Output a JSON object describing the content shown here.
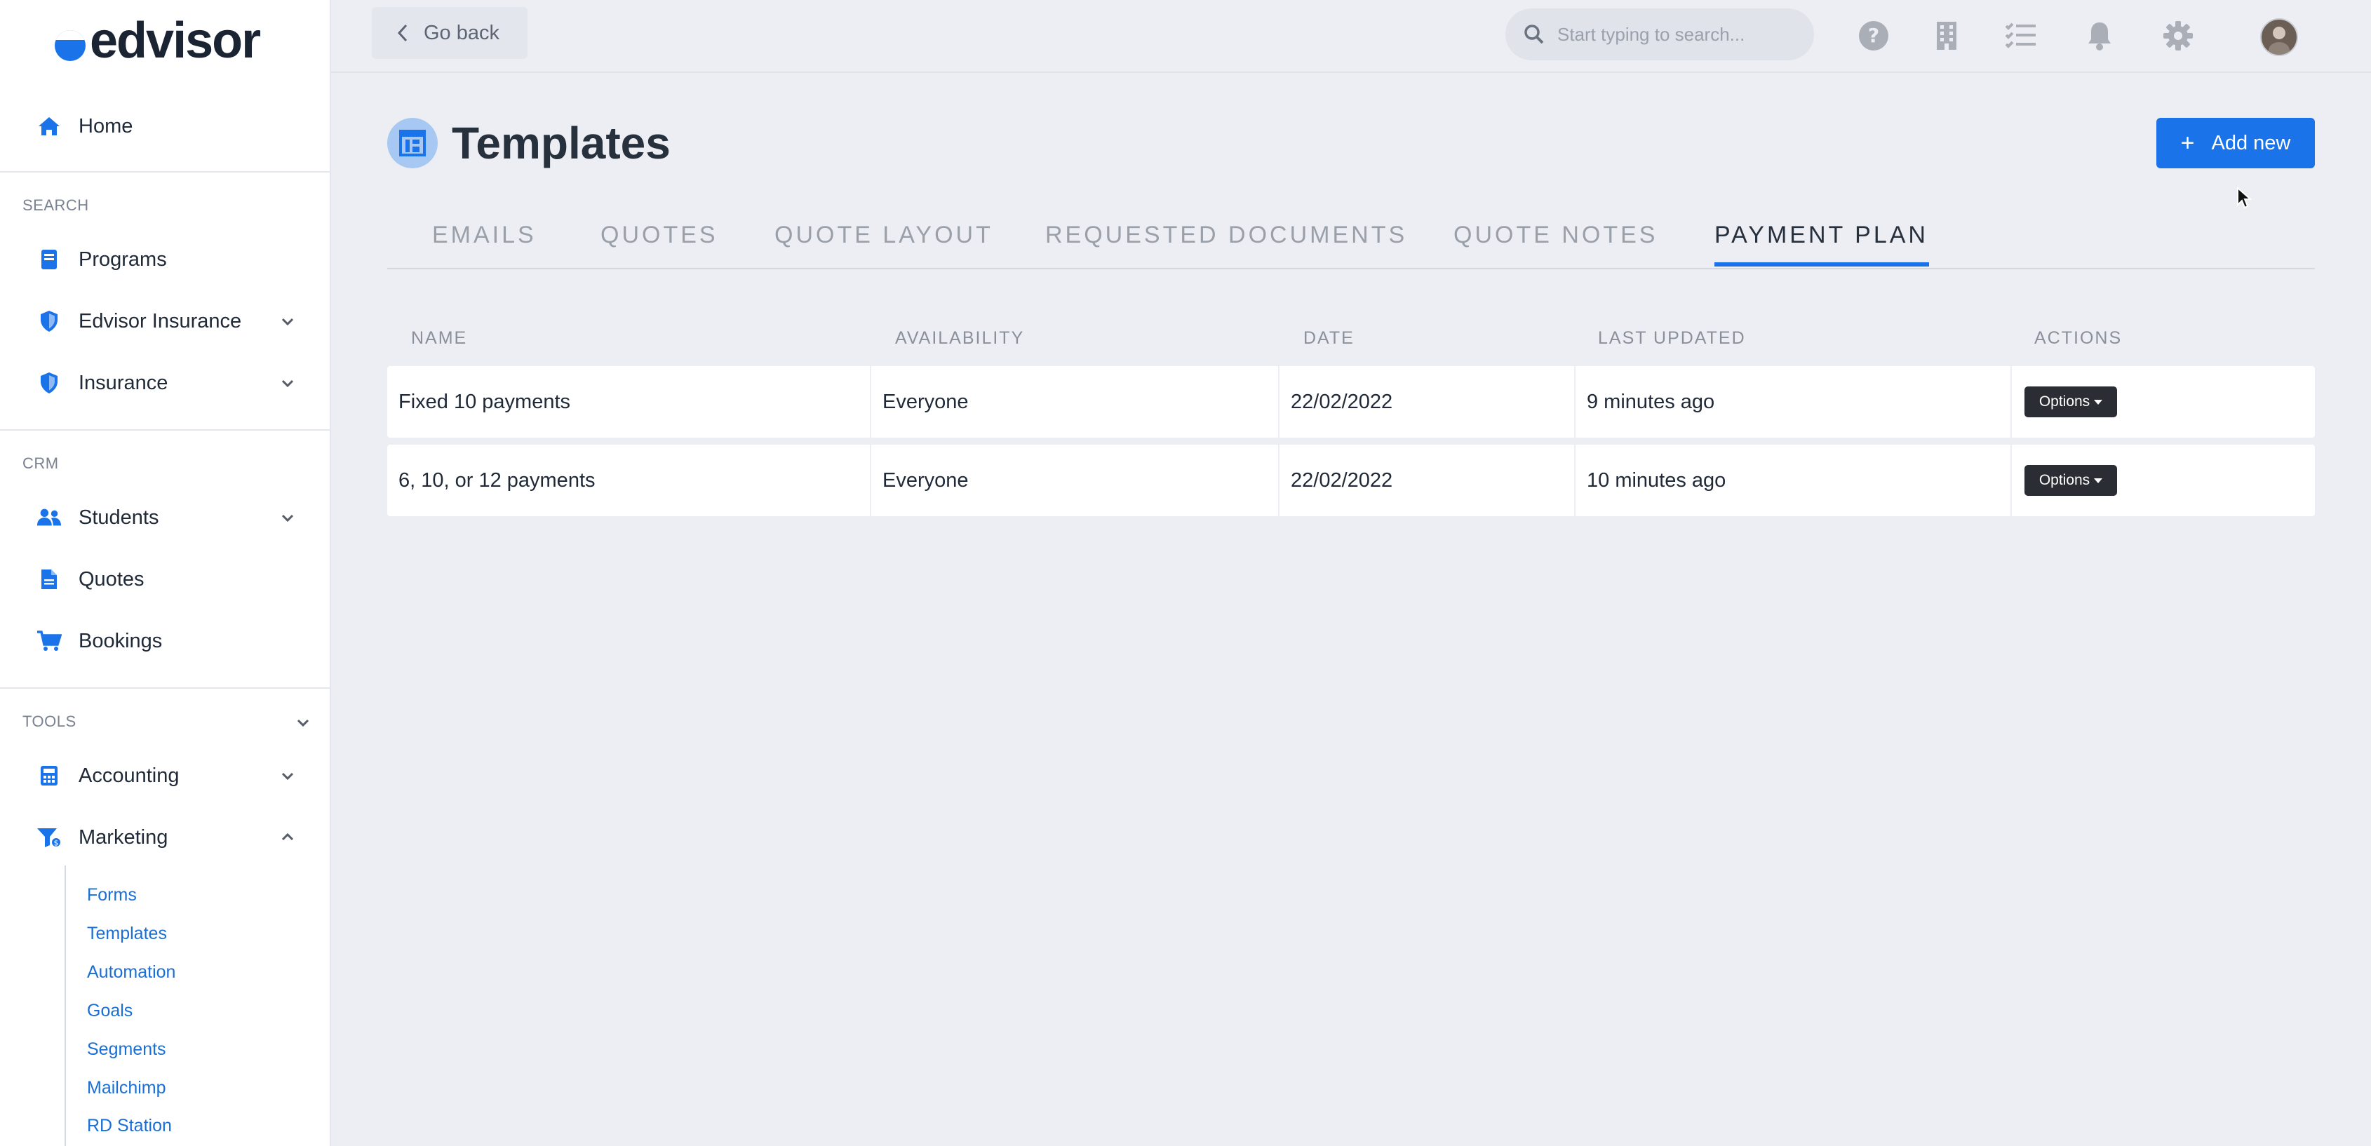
{
  "brand": {
    "logo_text": "edvisor",
    "accent": "#1a73e8"
  },
  "sidebar": {
    "home": "Home",
    "sections": {
      "search": "SEARCH",
      "crm": "CRM",
      "tools": "TOOLS"
    },
    "search_items": [
      {
        "label": "Programs",
        "icon": "book-icon"
      },
      {
        "label": "Edvisor Insurance",
        "icon": "shield-icon"
      },
      {
        "label": "Insurance",
        "icon": "shield-icon"
      }
    ],
    "crm_items": [
      {
        "label": "Students",
        "icon": "users-icon"
      },
      {
        "label": "Quotes",
        "icon": "document-icon"
      },
      {
        "label": "Bookings",
        "icon": "cart-icon"
      }
    ],
    "tools_items": [
      {
        "label": "Accounting",
        "icon": "calculator-icon"
      },
      {
        "label": "Marketing",
        "icon": "funnel-icon"
      }
    ],
    "marketing_sub": [
      "Forms",
      "Templates",
      "Automation",
      "Goals",
      "Segments",
      "Mailchimp",
      "RD Station"
    ]
  },
  "topbar": {
    "go_back": "Go back",
    "search_placeholder": "Start typing to search...",
    "icons": [
      "help-icon",
      "building-icon",
      "checklist-icon",
      "bell-icon",
      "gear-icon"
    ]
  },
  "main": {
    "title": "Templates",
    "add_new": "Add new",
    "tabs": [
      "EMAILS",
      "QUOTES",
      "QUOTE LAYOUT",
      "REQUESTED DOCUMENTS",
      "QUOTE NOTES",
      "PAYMENT PLAN"
    ],
    "active_tab": "PAYMENT PLAN",
    "table": {
      "columns": [
        "NAME",
        "AVAILABILITY",
        "DATE",
        "LAST UPDATED",
        "ACTIONS"
      ],
      "rows": [
        {
          "name": "Fixed 10 payments",
          "availability": "Everyone",
          "date": "22/02/2022",
          "last_updated": "9 minutes ago",
          "action": "Options"
        },
        {
          "name": "6, 10, or 12 payments",
          "availability": "Everyone",
          "date": "22/02/2022",
          "last_updated": "10 minutes ago",
          "action": "Options"
        }
      ]
    }
  }
}
